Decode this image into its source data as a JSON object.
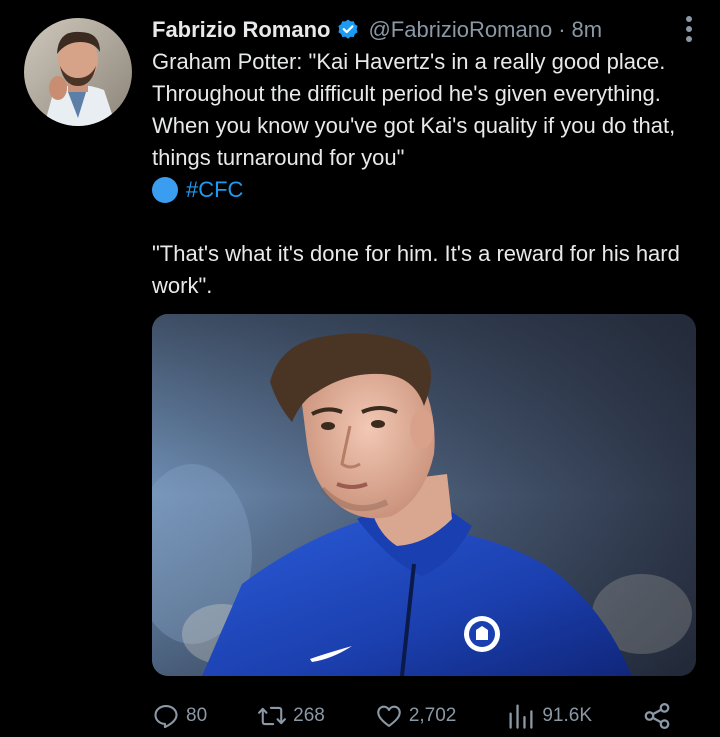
{
  "author": {
    "name": "Fabrizio Romano",
    "handle": "@FabrizioRomano",
    "separator": "·",
    "time": "8m"
  },
  "tweet": {
    "paragraph1": "Graham Potter: \"Kai Havertz's in a really good place. Throughout the difficult period he's given everything. When you know you've got Kai's quality if you do that, things turnaround for you\"",
    "hashtag": "#CFC",
    "paragraph2": "\"That's what it's done for him. It's a reward for his hard work\"."
  },
  "icons": {
    "verified": "verified-badge-icon",
    "more": "more-options-icon",
    "reply": "reply-icon",
    "retweet": "retweet-icon",
    "like": "like-icon",
    "views": "views-icon",
    "share": "share-icon"
  },
  "actions": {
    "replies": "80",
    "retweets": "268",
    "likes": "2,702",
    "views": "91.6K"
  },
  "colors": {
    "background": "#000000",
    "text": "#e7e9ea",
    "muted": "#8b98a5",
    "accent": "#1d9bf0"
  }
}
